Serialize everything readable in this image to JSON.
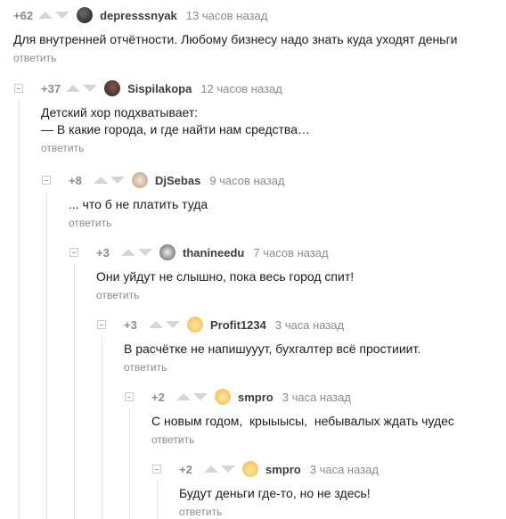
{
  "comments": [
    {
      "rating": "+62",
      "author": "depresssnyak",
      "time": "13 часов назад",
      "text": [
        "Для внутренней отчётности. Любому бизнесу надо знать куда уходят деньги"
      ],
      "reply": "ответить",
      "avatar": "dark"
    },
    {
      "rating": "+37",
      "author": "Sispilakopa",
      "time": "12 часов назад",
      "text": [
        "Детский хор подхватывает:",
        "— В какие города, и где найти нам средства…"
      ],
      "reply": "ответить",
      "avatar": "sis"
    },
    {
      "rating": "+8",
      "author": "DjSebas",
      "time": "9 часов назад",
      "text": [
        "... что б не платить туда"
      ],
      "reply": "ответить",
      "avatar": "dj"
    },
    {
      "rating": "+3",
      "author": "thanineedu",
      "time": "7 часов назад",
      "text": [
        "Они уйдут не слышно, пока весь город спит!"
      ],
      "reply": "ответить",
      "avatar": "than"
    },
    {
      "rating": "+3",
      "author": "Profit1234",
      "time": "3 часа назад",
      "text": [
        "В расчётке не напишууут, бухгалтер всё простииит."
      ],
      "reply": "ответить",
      "avatar": "cat"
    },
    {
      "rating": "+2",
      "author": "smpro",
      "time": "3 часа назад",
      "text": [
        "С новым годом,  крыыысы,  небывалых ждать чудес"
      ],
      "reply": "ответить",
      "avatar": "cat"
    },
    {
      "rating": "+2",
      "author": "smpro",
      "time": "3 часа назад",
      "text": [
        "Будут деньги где-то, но не здесь!"
      ],
      "reply": "ответить",
      "avatar": "cat"
    }
  ]
}
